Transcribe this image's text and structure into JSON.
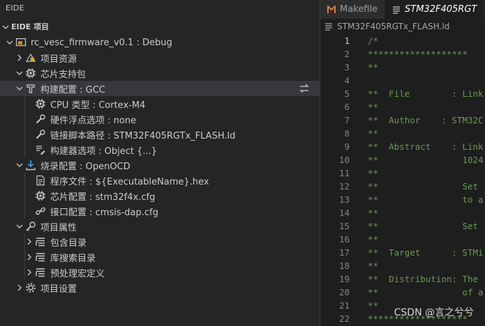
{
  "sidebar": {
    "title": "EIDE",
    "section": "EIDE 项目",
    "tree": [
      {
        "label": "rc_vesc_firmware_v0.1 : Debug",
        "depth": 0,
        "chevron": "down",
        "icon": "project-icon"
      },
      {
        "label": "项目资源",
        "depth": 1,
        "chevron": "right",
        "icon": "resources-icon"
      },
      {
        "label": "芯片支持包",
        "depth": 1,
        "chevron": "down",
        "icon": "chip-icon"
      },
      {
        "label": "构建配置 : GCC",
        "depth": 1,
        "chevron": "down",
        "icon": "build-icon",
        "selected": true
      },
      {
        "label": "CPU 类型 : Cortex-M4",
        "depth": 2,
        "chevron": "none",
        "icon": "cpu-icon"
      },
      {
        "label": "硬件浮点选项 : none",
        "depth": 2,
        "chevron": "none",
        "icon": "wrench-icon"
      },
      {
        "label": "链接脚本路径 : STM32F405RGTx_FLASH.ld",
        "depth": 2,
        "chevron": "none",
        "icon": "wrench-icon"
      },
      {
        "label": "构建器选项 : Object {...}",
        "depth": 2,
        "chevron": "none",
        "icon": "options-icon"
      },
      {
        "label": "烧录配置 : OpenOCD",
        "depth": 1,
        "chevron": "down",
        "icon": "download-icon"
      },
      {
        "label": "程序文件 : ${ExecutableName}.hex",
        "depth": 2,
        "chevron": "none",
        "icon": "file-icon"
      },
      {
        "label": "芯片配置 : stm32f4x.cfg",
        "depth": 2,
        "chevron": "none",
        "icon": "chip-icon"
      },
      {
        "label": "接口配置 : cmsis-dap.cfg",
        "depth": 2,
        "chevron": "none",
        "icon": "link-icon"
      },
      {
        "label": "项目属性",
        "depth": 1,
        "chevron": "down",
        "icon": "key-icon"
      },
      {
        "label": "包含目录",
        "depth": 2,
        "chevron": "right",
        "icon": "list-icon"
      },
      {
        "label": "库搜索目录",
        "depth": 2,
        "chevron": "right",
        "icon": "list-icon"
      },
      {
        "label": "预处理宏定义",
        "depth": 2,
        "chevron": "right",
        "icon": "list-icon"
      },
      {
        "label": "项目设置",
        "depth": 1,
        "chevron": "right",
        "icon": "gear-icon"
      }
    ]
  },
  "editor": {
    "tabs": [
      {
        "label": "Makefile",
        "icon": "makefile-icon",
        "active": false
      },
      {
        "label": "STM32F405RGT",
        "icon": "file-lines-icon",
        "active": true
      }
    ],
    "breadcrumb": "STM32F405RGTx_FLASH.ld",
    "current_line": 1,
    "lines": [
      {
        "n": "1",
        "t": "/*"
      },
      {
        "n": "2",
        "t": "*******************"
      },
      {
        "n": "3",
        "t": "**"
      },
      {
        "n": "4",
        "t": ""
      },
      {
        "n": "5",
        "t": "**  File        : Link"
      },
      {
        "n": "6",
        "t": "**"
      },
      {
        "n": "7",
        "t": "**  Author    : STM32C"
      },
      {
        "n": "8",
        "t": "**"
      },
      {
        "n": "9",
        "t": "**  Abstract    : Link"
      },
      {
        "n": "10",
        "t": "**                1024"
      },
      {
        "n": "11",
        "t": "**"
      },
      {
        "n": "12",
        "t": "**                Set"
      },
      {
        "n": "13",
        "t": "**                to a"
      },
      {
        "n": "14",
        "t": "**"
      },
      {
        "n": "15",
        "t": "**                Set"
      },
      {
        "n": "16",
        "t": "**"
      },
      {
        "n": "17",
        "t": "**  Target      : STMi"
      },
      {
        "n": "18",
        "t": "**"
      },
      {
        "n": "19",
        "t": "**  Distribution: The"
      },
      {
        "n": "20",
        "t": "**                of a"
      },
      {
        "n": "21",
        "t": "**"
      },
      {
        "n": "22",
        "t": "*******************"
      }
    ]
  },
  "watermark": "CSDN @言之兮兮",
  "colors": {
    "selection": "#37373d",
    "comment": "#6a9955",
    "makefile_icon": "#e37933",
    "chip_icon": "#d7d7d7"
  }
}
